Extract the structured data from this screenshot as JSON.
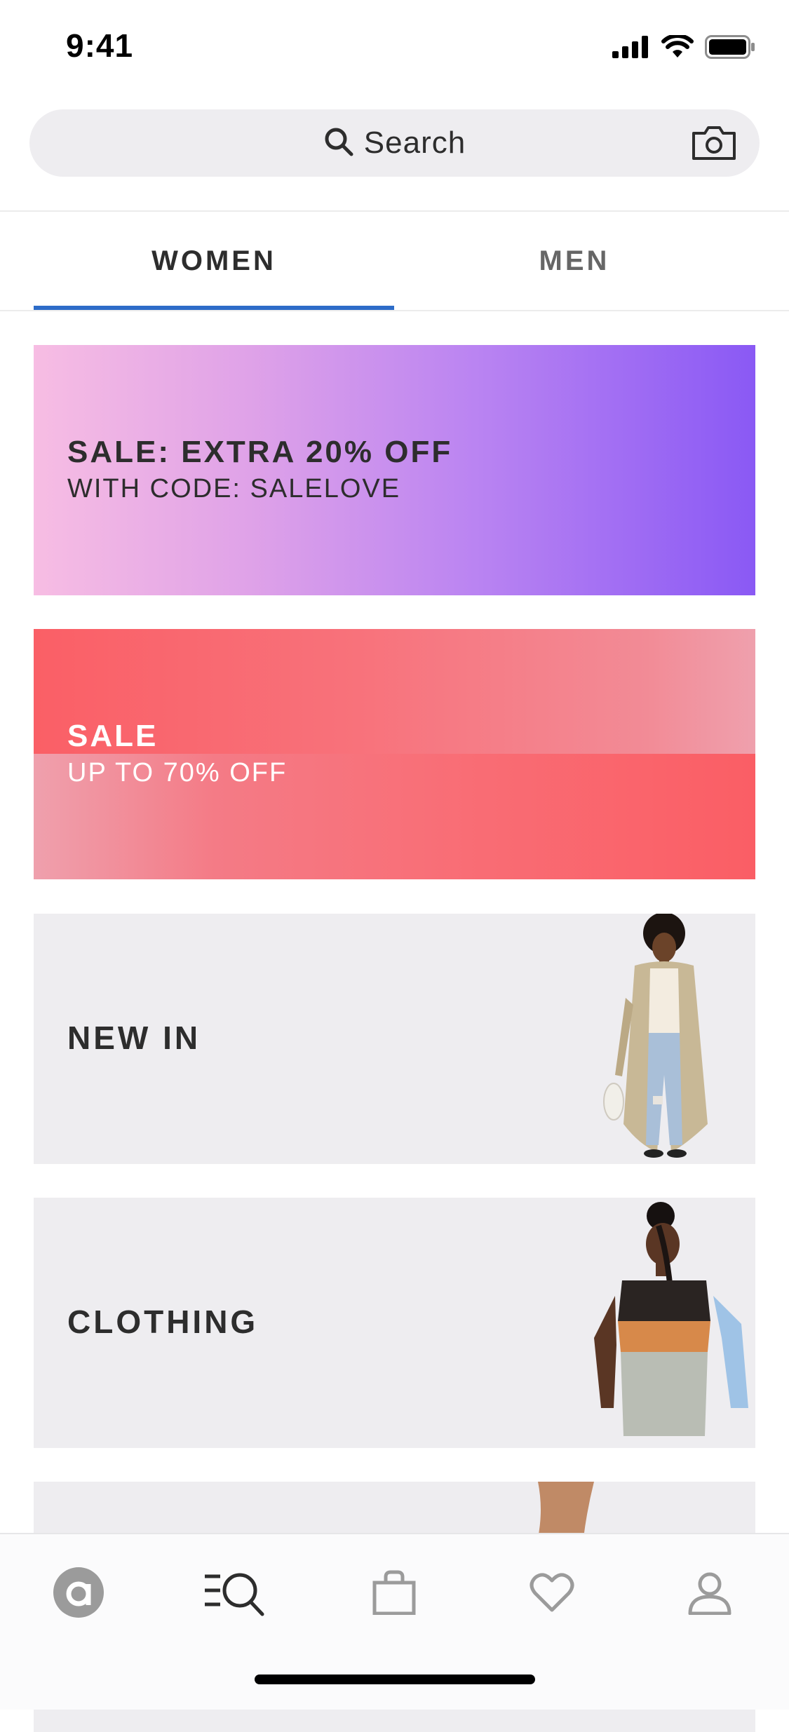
{
  "status_bar": {
    "time": "9:41"
  },
  "search": {
    "label": "Search"
  },
  "tabs": [
    {
      "label": "WOMEN",
      "selected": true
    },
    {
      "label": "MEN",
      "selected": false
    }
  ],
  "banners": [
    {
      "title": "SALE: EXTRA 20% OFF",
      "subtitle": "WITH CODE: SALELOVE"
    },
    {
      "title": "SALE",
      "subtitle": "UP TO 70% OFF"
    }
  ],
  "categories": [
    {
      "label": "NEW IN"
    },
    {
      "label": "CLOTHING"
    },
    {
      "label": ""
    }
  ],
  "bottom_nav": [
    {
      "icon": "home-icon",
      "active": false
    },
    {
      "icon": "browse-icon",
      "active": true
    },
    {
      "icon": "bag-icon",
      "active": false
    },
    {
      "icon": "heart-icon",
      "active": false
    },
    {
      "icon": "account-icon",
      "active": false
    }
  ],
  "colors": {
    "tab_indicator": "#2d6cc8",
    "tile_background": "#eeedf0"
  }
}
